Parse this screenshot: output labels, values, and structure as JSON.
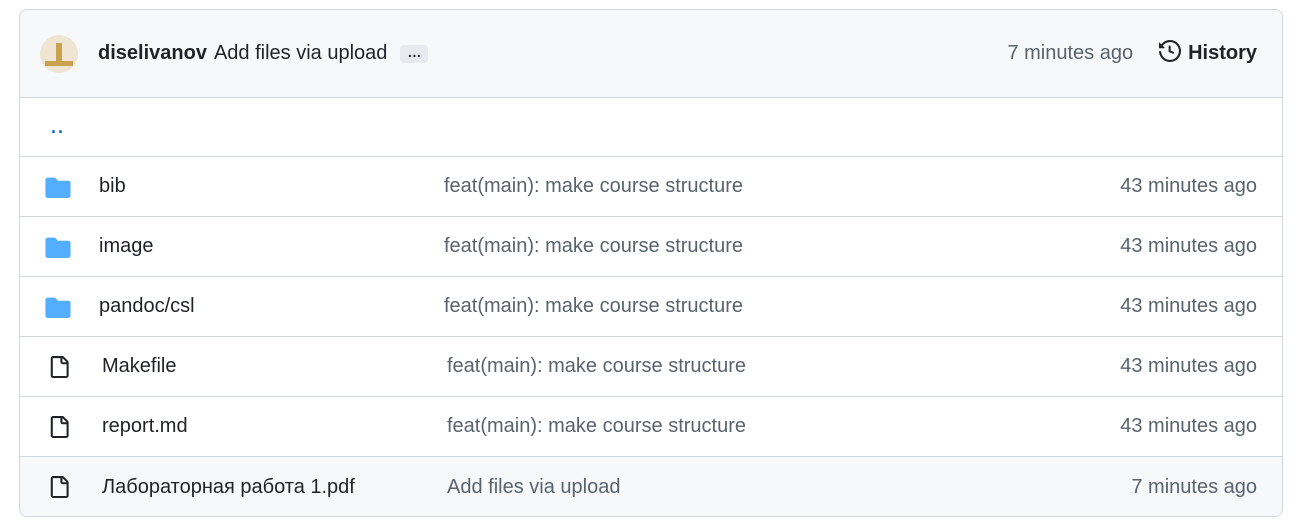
{
  "header": {
    "author": "diselivanov",
    "message": "Add files via upload",
    "ellipsis": "…",
    "time": "7 minutes ago",
    "history_label": "History"
  },
  "parent_link": "..",
  "files": [
    {
      "type": "folder",
      "icon": "folder-icon",
      "name": "bib",
      "message": "feat(main): make course structure",
      "time": "43 minutes ago"
    },
    {
      "type": "folder",
      "icon": "folder-icon",
      "name": "image",
      "message": "feat(main): make course structure",
      "time": "43 minutes ago"
    },
    {
      "type": "folder",
      "icon": "folder-icon",
      "name": "pandoc/csl",
      "message": "feat(main): make course structure",
      "time": "43 minutes ago"
    },
    {
      "type": "file",
      "icon": "file-icon",
      "name": "Makefile",
      "message": "feat(main): make course structure",
      "time": "43 minutes ago"
    },
    {
      "type": "file",
      "icon": "file-icon",
      "name": "report.md",
      "message": "feat(main): make course structure",
      "time": "43 minutes ago"
    },
    {
      "type": "file",
      "icon": "file-icon",
      "name": "Лабораторная работа 1.pdf",
      "message": "Add files via upload",
      "time": "7 minutes ago"
    }
  ],
  "colors": {
    "folder": "#54aeff",
    "link": "#0969da",
    "muted": "#59636e"
  }
}
